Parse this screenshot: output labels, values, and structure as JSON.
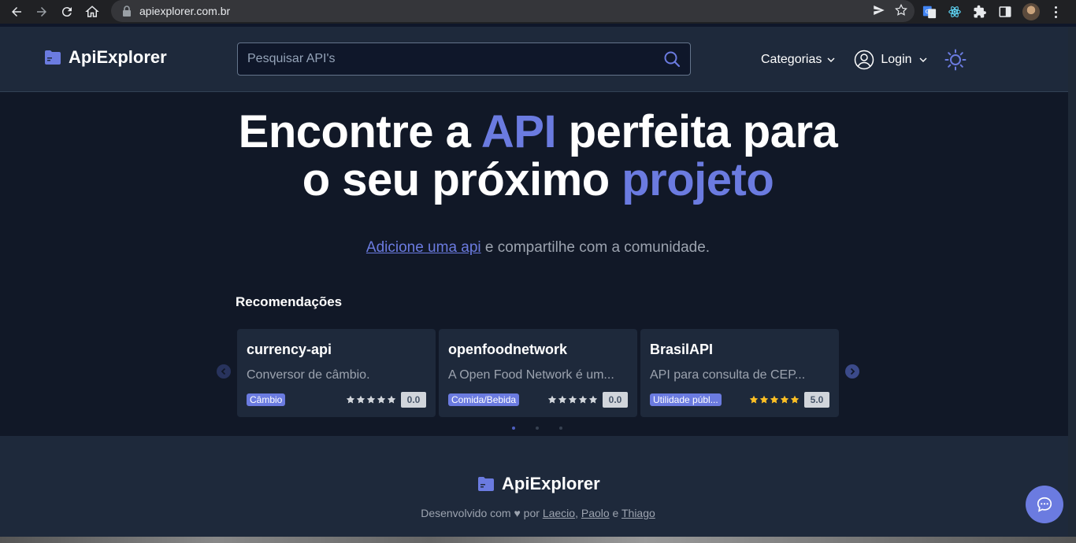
{
  "browser": {
    "url": "apiexplorer.com.br"
  },
  "header": {
    "logo_text": "ApiExplorer",
    "search_placeholder": "Pesquisar API's",
    "categories_label": "Categorias",
    "login_label": "Login"
  },
  "hero": {
    "line1_a": "Encontre a ",
    "line1_accent": "API",
    "line1_b": " perfeita para",
    "line2_a": "o seu próximo ",
    "line2_accent": "projeto"
  },
  "subline": {
    "link": "Adicione uma api",
    "rest": " e compartilhe com a comunidade."
  },
  "recommendations": {
    "title": "Recomendações",
    "cards": [
      {
        "title": "currency-api",
        "description": "Conversor de câmbio.",
        "tag": "Câmbio",
        "score": "0.0",
        "stars_filled": 0
      },
      {
        "title": "openfoodnetwork",
        "description": "A Open Food Network é um...",
        "tag": "Comida/Bebida",
        "score": "0.0",
        "stars_filled": 0
      },
      {
        "title": "BrasilAPI",
        "description": "API para consulta de CEP...",
        "tag": "Utilidade públ...",
        "score": "5.0",
        "stars_filled": 5
      }
    ],
    "page_count": 3,
    "active_page": 1
  },
  "footer": {
    "logo_text": "ApiExplorer",
    "credits_prefix": "Desenvolvido com ♥ por ",
    "author1": "Laecio",
    "sep1": ", ",
    "author2": "Paolo",
    "sep2": " e ",
    "author3": "Thiago"
  },
  "colors": {
    "accent": "#6b7be0",
    "background": "#111827",
    "surface": "#1e293b",
    "star_filled": "#fbbf24",
    "star_empty": "#d1d5db"
  }
}
